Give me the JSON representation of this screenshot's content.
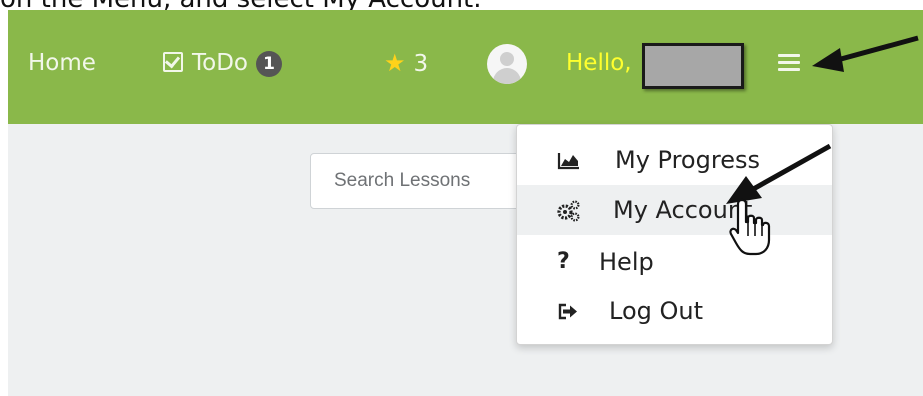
{
  "caption": "on the Menu, and select My Account.",
  "navbar": {
    "home_label": "Home",
    "todo_label": "ToDo",
    "todo_badge": "1",
    "stars_count": "3",
    "hello_label": "Hello,"
  },
  "search": {
    "placeholder": "Search Lessons"
  },
  "dropdown": {
    "items": [
      {
        "label": "My Progress",
        "icon": "area-chart-icon"
      },
      {
        "label": "My Account",
        "icon": "gears-icon"
      },
      {
        "label": "Help",
        "icon": "question-icon"
      },
      {
        "label": "Log Out",
        "icon": "sign-out-icon"
      }
    ]
  },
  "colors": {
    "navbar": "#8ab84a",
    "hello_text": "#ffff2e",
    "star": "#ffd21a",
    "content_bg": "#eef0f1"
  }
}
